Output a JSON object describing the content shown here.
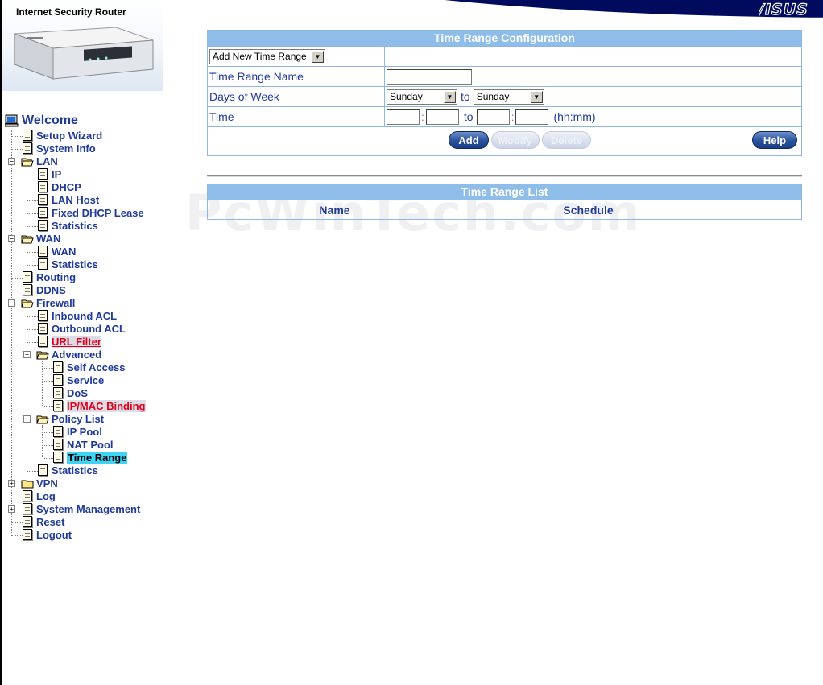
{
  "header": {
    "product_title": "Internet Security Router",
    "brand": "/ISUS"
  },
  "nav": {
    "items": [
      {
        "label": "Welcome"
      },
      {
        "label": "Setup Wizard"
      },
      {
        "label": "System Info"
      },
      {
        "label": "LAN"
      },
      {
        "label": "IP"
      },
      {
        "label": "DHCP"
      },
      {
        "label": "LAN Host"
      },
      {
        "label": "Fixed DHCP Lease"
      },
      {
        "label": "Statistics"
      },
      {
        "label": "WAN"
      },
      {
        "label": "WAN"
      },
      {
        "label": "Statistics"
      },
      {
        "label": "Routing"
      },
      {
        "label": "DDNS"
      },
      {
        "label": "Firewall"
      },
      {
        "label": "Inbound ACL"
      },
      {
        "label": "Outbound ACL"
      },
      {
        "label": "URL Filter"
      },
      {
        "label": "Advanced"
      },
      {
        "label": "Self Access"
      },
      {
        "label": "Service"
      },
      {
        "label": "DoS"
      },
      {
        "label": "IP/MAC Binding"
      },
      {
        "label": "Policy List"
      },
      {
        "label": "IP Pool"
      },
      {
        "label": "NAT Pool"
      },
      {
        "label": "Time Range"
      },
      {
        "label": "Statistics"
      },
      {
        "label": "VPN"
      },
      {
        "label": "Log"
      },
      {
        "label": "System Management"
      },
      {
        "label": "Reset"
      },
      {
        "label": "Logout"
      }
    ]
  },
  "config": {
    "title": "Time Range Configuration",
    "selector_value": "Add New Time Range",
    "name_label": "Time Range Name",
    "name_value": "",
    "days_label": "Days of Week",
    "day_from": "Sunday",
    "day_to": "Sunday",
    "to_label": "to",
    "time_label": "Time",
    "colon": ":",
    "time_format": "(hh:mm)",
    "buttons": {
      "add": "Add",
      "modify": "Modify",
      "delete": "Delete",
      "help": "Help"
    }
  },
  "list": {
    "title": "Time Range List",
    "columns": [
      "Name",
      "Schedule"
    ]
  },
  "watermark": "PcWinTech.com"
}
